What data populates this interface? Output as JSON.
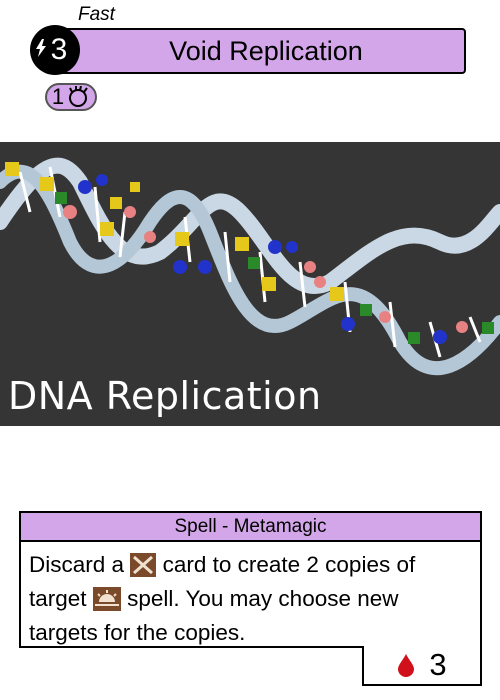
{
  "card": {
    "speed": "Fast",
    "title": "Void Replication",
    "cost": "3",
    "resource_cost": "1",
    "type_line": "Spell - Metamagic",
    "rules": {
      "part1": "Discard a",
      "part2": "card to create 2 copies of target",
      "part3": "spell. You may choose new targets for the copies."
    },
    "footer_value": "3"
  },
  "art": {
    "caption": "DNA Replication"
  },
  "icons": {
    "cost": "lightning-icon",
    "resource": "void-swirl-icon",
    "rules_card": "crossed-swords-icon",
    "rules_spell": "sunrise-icon",
    "footer": "blood-drop-icon"
  },
  "colors": {
    "accent": "#d2a6e8",
    "art_background": "#353535",
    "blood": "#d0101a",
    "icon_brown": "#7a4a2a"
  }
}
